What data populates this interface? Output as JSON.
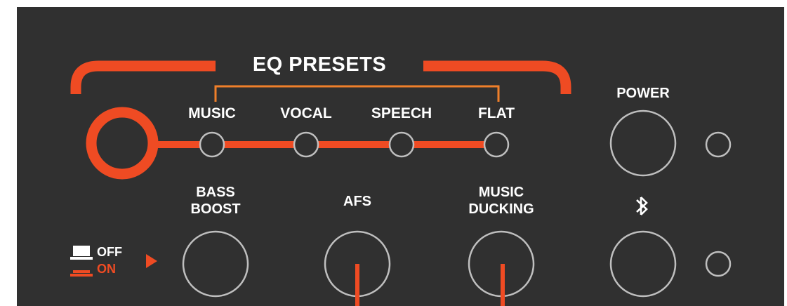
{
  "colors": {
    "panel": "#303030",
    "accent": "#ef4b23",
    "bracket": "#f07f2a",
    "ring": "#bfbfbf",
    "text": "#ffffff"
  },
  "eq_presets": {
    "title": "EQ PRESETS",
    "presets": [
      {
        "label": "MUSIC"
      },
      {
        "label": "VOCAL"
      },
      {
        "label": "SPEECH"
      },
      {
        "label": "FLAT"
      }
    ]
  },
  "buttons": {
    "bass_boost": {
      "line1": "BASS",
      "line2": "BOOST"
    },
    "afs": {
      "label": "AFS"
    },
    "music_ducking": {
      "line1": "MUSIC",
      "line2": "DUCKING"
    },
    "power": {
      "label": "POWER"
    },
    "bluetooth": {
      "icon": "bluetooth-icon"
    }
  },
  "switch_legend": {
    "off_label": "OFF",
    "on_label": "ON",
    "icons": [
      "button-up-icon",
      "button-pressed-icon",
      "triangle-right-icon"
    ]
  }
}
